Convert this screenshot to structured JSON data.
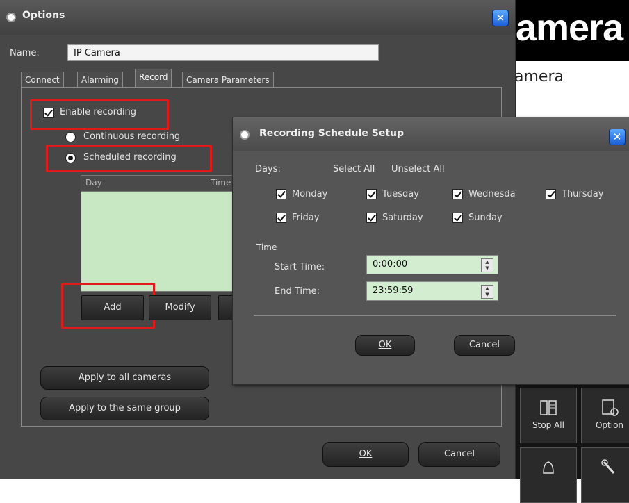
{
  "background_app": {
    "banner_text": "amera",
    "subtitle": "amera",
    "toolbar": {
      "stop_all_label": "Stop All",
      "options_label": "Option",
      "icons": [
        "stop-all-icon",
        "options-icon",
        "bell-icon",
        "wrench-icon"
      ]
    }
  },
  "options_dialog": {
    "title": "Options",
    "name_label": "Name:",
    "name_value": "IP Camera",
    "tabs": [
      {
        "label": "Connect",
        "active": false
      },
      {
        "label": "Alarming",
        "active": false
      },
      {
        "label": "Record",
        "active": true
      },
      {
        "label": "Camera Parameters",
        "active": false
      }
    ],
    "record": {
      "enable_recording_label": "Enable recording",
      "enable_recording_checked": true,
      "continuous_label": "Continuous recording",
      "scheduled_label": "Scheduled recording",
      "recording_mode": "Scheduled recording",
      "schedule_columns": [
        "Day",
        "Time"
      ],
      "schedule_rows": [],
      "add_label": "Add",
      "modify_label": "Modify",
      "apply_all_label": "Apply to all cameras",
      "apply_group_label": "Apply to the same group"
    },
    "ok_label": "OK",
    "cancel_label": "Cancel"
  },
  "schedule_dialog": {
    "title": "Recording Schedule Setup",
    "days_label": "Days:",
    "select_all_label": "Select All",
    "unselect_all_label": "Unselect All",
    "days": [
      {
        "label": "Monday",
        "checked": true
      },
      {
        "label": "Tuesday",
        "checked": true
      },
      {
        "label": "Wednesda",
        "checked": true
      },
      {
        "label": "Thursday",
        "checked": true
      },
      {
        "label": "Friday",
        "checked": true
      },
      {
        "label": "Saturday",
        "checked": true
      },
      {
        "label": "Sunday",
        "checked": true
      }
    ],
    "time_label": "Time",
    "start_time_label": "Start Time:",
    "start_time_value": "0:00:00",
    "end_time_label": "End Time:",
    "end_time_value": "23:59:59",
    "ok_label": "OK",
    "cancel_label": "Cancel"
  },
  "colors": {
    "dialog_bg": "#474747",
    "list_bg": "#c8e8c4",
    "highlight_red": "#e01a1a",
    "close_blue": "#1c5fd6"
  }
}
